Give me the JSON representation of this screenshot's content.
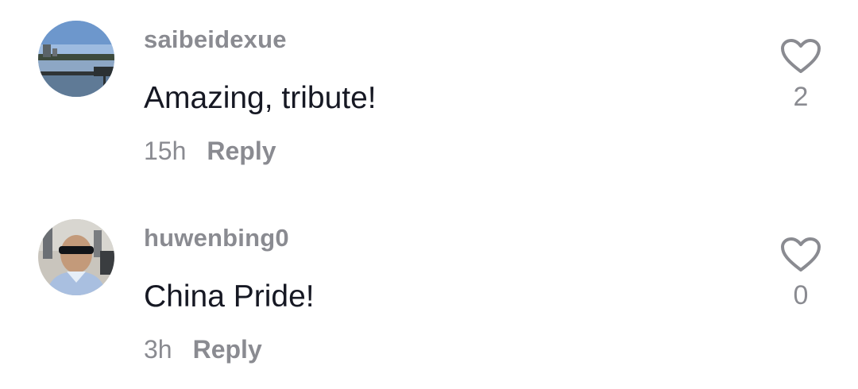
{
  "comments": [
    {
      "username": "saibeidexue",
      "text": "Amazing, tribute!",
      "time": "15h",
      "reply_label": "Reply",
      "likes": "2",
      "avatar": "lake-landscape-photo"
    },
    {
      "username": "huwenbing0",
      "text": "China Pride!",
      "time": "3h",
      "reply_label": "Reply",
      "likes": "0",
      "avatar": "man-with-sunglasses-photo"
    }
  ],
  "icons": {
    "like": "heart-outline-icon"
  },
  "colors": {
    "secondary_text": "#8a8b91",
    "primary_text": "#161823",
    "icon_stroke": "#8a8b91"
  }
}
